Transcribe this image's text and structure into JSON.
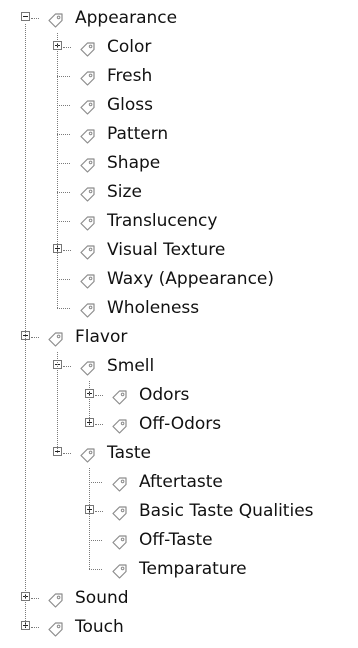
{
  "tag_icon": "tag-icon",
  "colors": {
    "text": "#111111",
    "tag_outline": "#8c8c8c",
    "guide_lines": "#7a7a7a",
    "background": "#ffffff"
  },
  "tree": [
    {
      "id": "appearance",
      "label": "Appearance",
      "level": 0,
      "toggle": "minus",
      "children": [
        {
          "id": "color",
          "label": "Color",
          "level": 1,
          "toggle": "plus"
        },
        {
          "id": "fresh",
          "label": "Fresh",
          "level": 1,
          "toggle": null
        },
        {
          "id": "gloss",
          "label": "Gloss",
          "level": 1,
          "toggle": null
        },
        {
          "id": "pattern",
          "label": "Pattern",
          "level": 1,
          "toggle": null
        },
        {
          "id": "shape",
          "label": "Shape",
          "level": 1,
          "toggle": null
        },
        {
          "id": "size",
          "label": "Size",
          "level": 1,
          "toggle": null
        },
        {
          "id": "translucency",
          "label": "Translucency",
          "level": 1,
          "toggle": null
        },
        {
          "id": "visual-texture",
          "label": "Visual Texture",
          "level": 1,
          "toggle": "plus"
        },
        {
          "id": "waxy-appearance",
          "label": "Waxy (Appearance)",
          "level": 1,
          "toggle": null
        },
        {
          "id": "wholeness",
          "label": "Wholeness",
          "level": 1,
          "toggle": null
        }
      ]
    },
    {
      "id": "flavor",
      "label": "Flavor",
      "level": 0,
      "toggle": "minus",
      "children": [
        {
          "id": "smell",
          "label": "Smell",
          "level": 1,
          "toggle": "minus",
          "children": [
            {
              "id": "odors",
              "label": "Odors",
              "level": 2,
              "toggle": "plus"
            },
            {
              "id": "off-odors",
              "label": "Off-Odors",
              "level": 2,
              "toggle": "plus"
            }
          ]
        },
        {
          "id": "taste",
          "label": "Taste",
          "level": 1,
          "toggle": "minus",
          "children": [
            {
              "id": "aftertaste",
              "label": "Aftertaste",
              "level": 2,
              "toggle": null
            },
            {
              "id": "basic-taste-qualities",
              "label": "Basic Taste Qualities",
              "level": 2,
              "toggle": "plus"
            },
            {
              "id": "off-taste",
              "label": "Off-Taste",
              "level": 2,
              "toggle": null
            },
            {
              "id": "temparature",
              "label": "Temparature",
              "level": 2,
              "toggle": null
            }
          ]
        }
      ]
    },
    {
      "id": "sound",
      "label": "Sound",
      "level": 0,
      "toggle": "plus"
    },
    {
      "id": "touch",
      "label": "Touch",
      "level": 0,
      "toggle": "plus"
    }
  ]
}
